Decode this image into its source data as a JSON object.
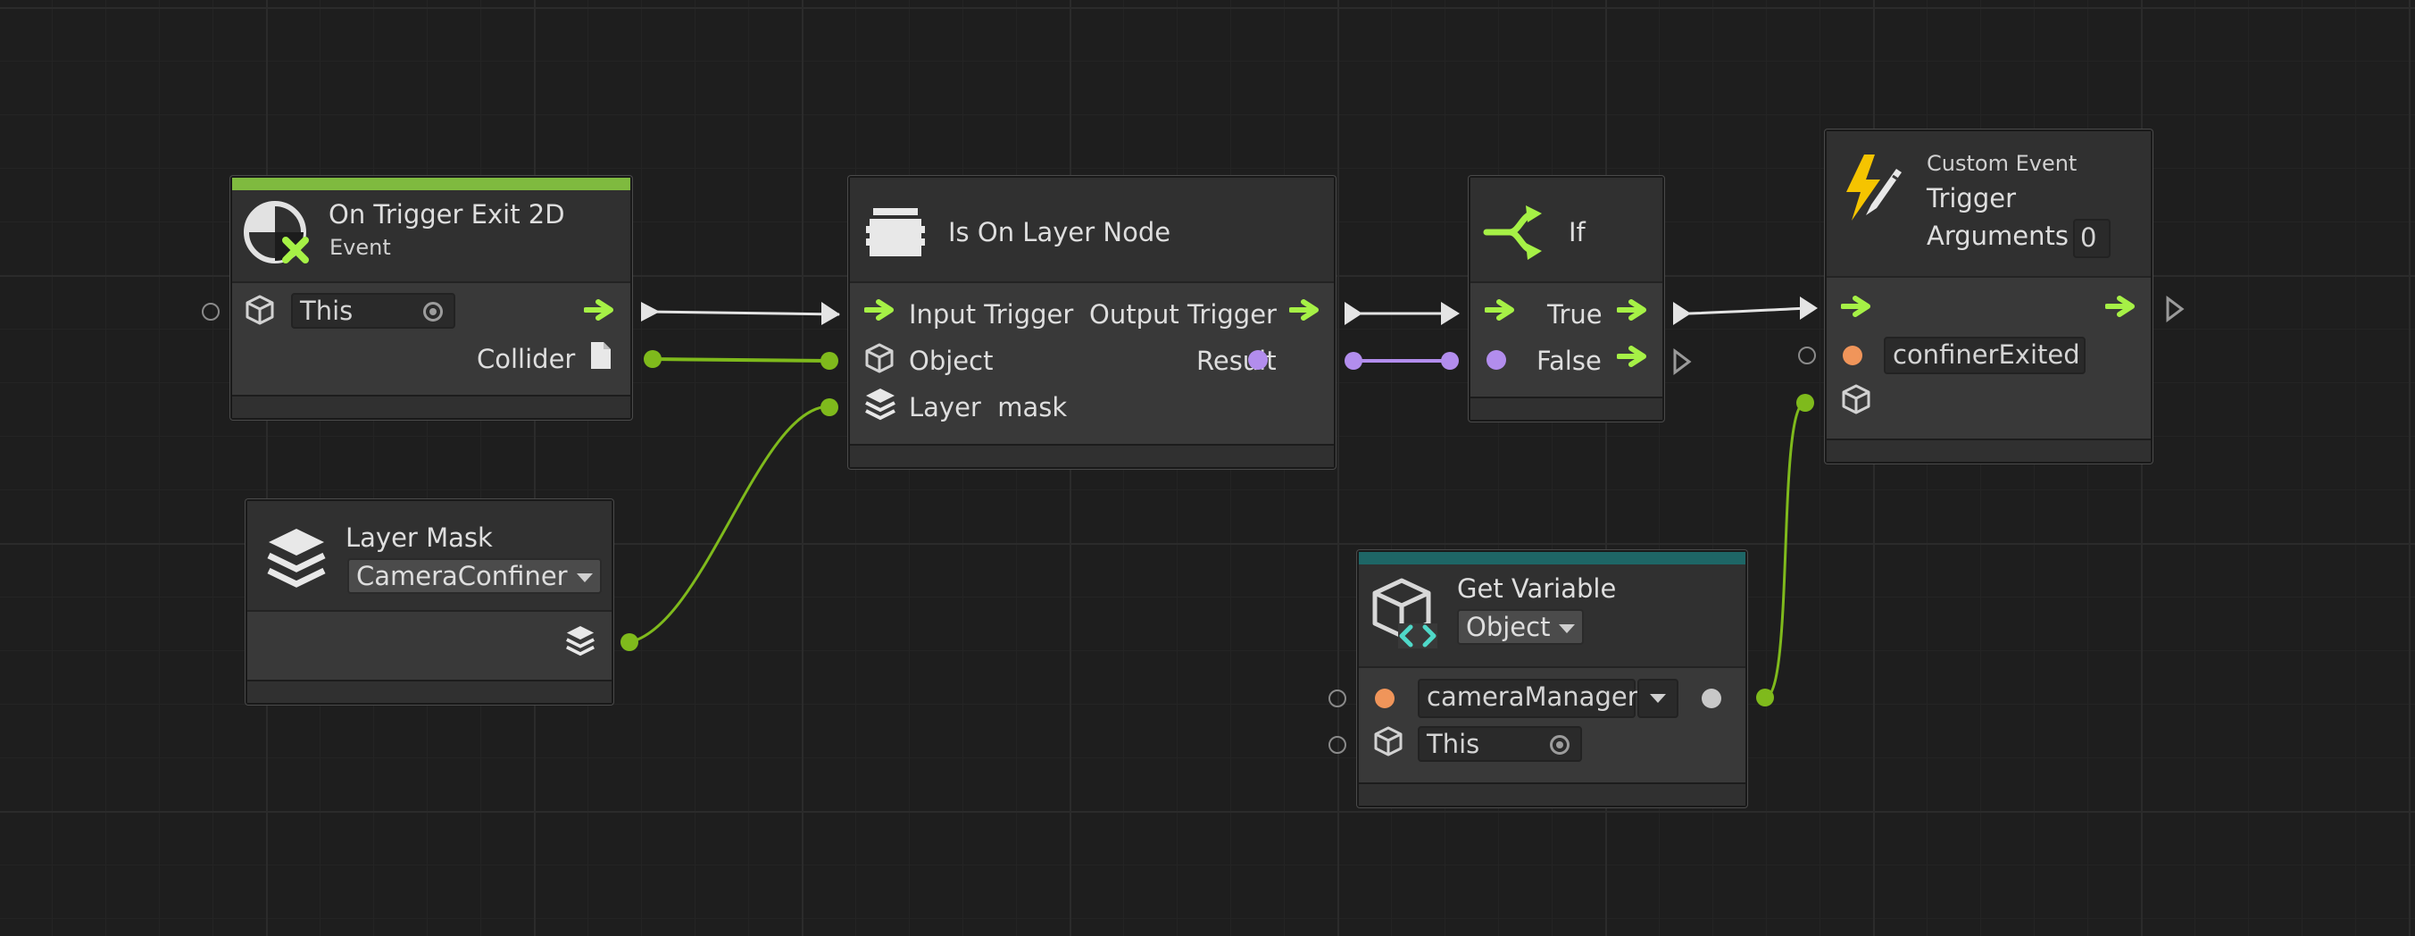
{
  "nodes": {
    "on_trigger_exit": {
      "title": "On Trigger Exit 2D",
      "subtitle": "Event",
      "target_value": "This",
      "output_label": "Collider"
    },
    "is_on_layer": {
      "title": "Is On Layer Node",
      "input_trigger": "Input Trigger",
      "output_trigger": "Output Trigger",
      "object_label": "Object",
      "result_label": "Result",
      "layer_mask_label": "Layer  mask"
    },
    "if_node": {
      "title": "If",
      "true_label": "True",
      "false_label": "False"
    },
    "custom_event": {
      "overline": "Custom Event",
      "title_line1": "Trigger",
      "title_line2": "Arguments",
      "arguments_count": "0",
      "event_name": "confinerExited"
    },
    "layer_mask": {
      "title": "Layer Mask",
      "selected": "CameraConfiner"
    },
    "get_variable": {
      "title": "Get Variable",
      "kind": "Object",
      "variable_name": "cameraManager",
      "target_value": "This"
    }
  },
  "colors": {
    "background": "#1e1e1e",
    "node_body": "#393939",
    "control_flow": "#a6f146",
    "object_port": "#7fba1c",
    "boolean_port": "#b28ded",
    "string_port": "#f0955a",
    "event_bar": "#7fba3f",
    "variable_bar": "#1e6666"
  },
  "icons": {
    "event": "trigger-exit-event-icon",
    "is_on_layer": "node-box-icon",
    "if": "branch-icon",
    "custom_event": "lightning-pencil-icon",
    "layer_mask": "layers-icon",
    "get_variable": "variable-cube-icon"
  }
}
